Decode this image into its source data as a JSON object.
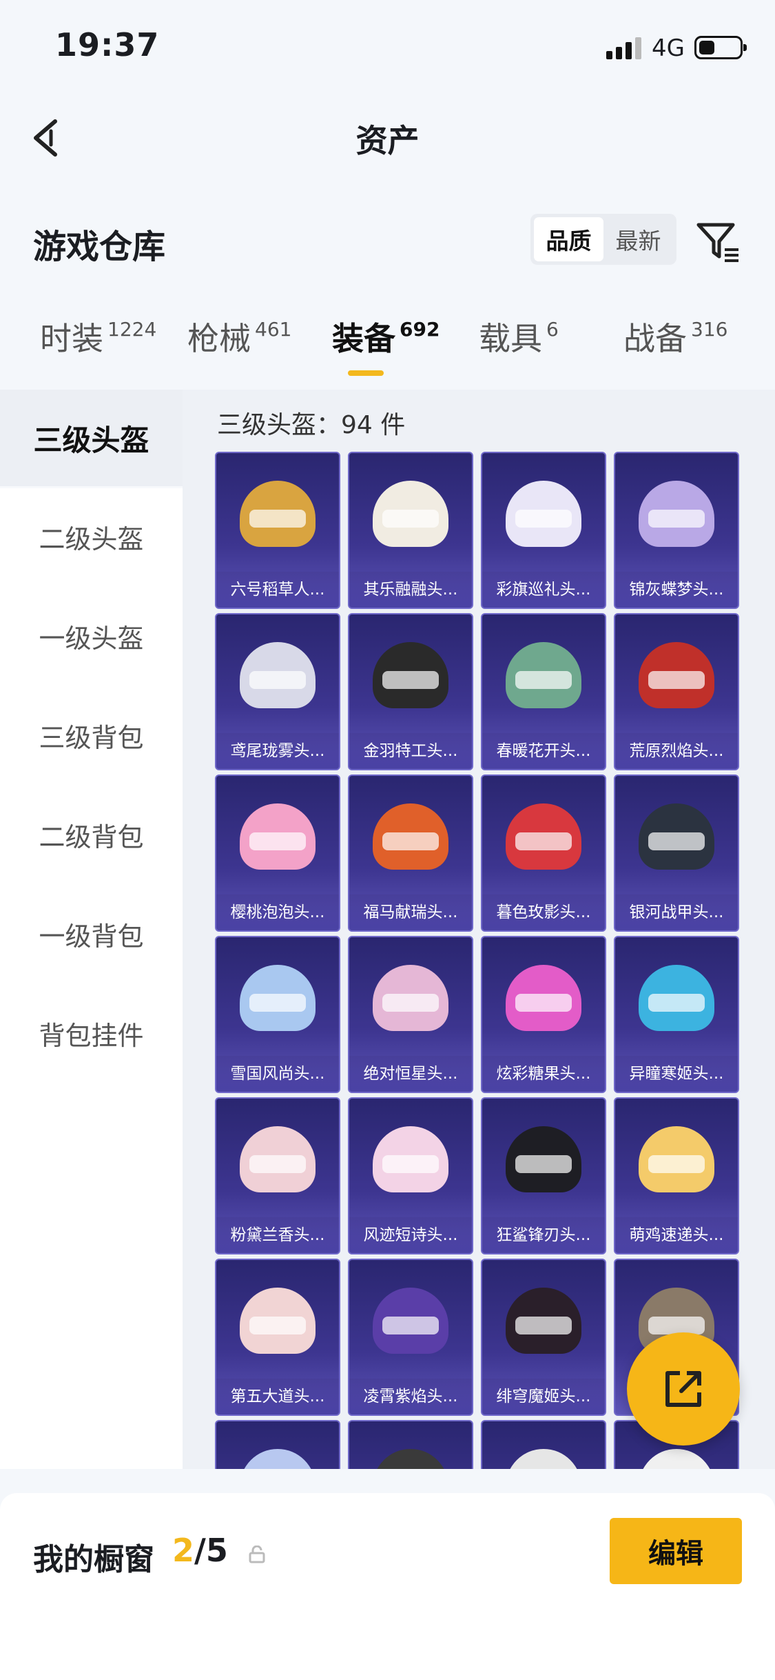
{
  "status_bar": {
    "time": "19:37",
    "network": "4G"
  },
  "nav": {
    "title": "资产"
  },
  "warehouse": {
    "title": "游戏仓库",
    "sort_options": [
      {
        "label": "品质",
        "active": true
      },
      {
        "label": "最新",
        "active": false
      }
    ]
  },
  "tabs": [
    {
      "label": "时装",
      "count": "1224",
      "active": false
    },
    {
      "label": "枪械",
      "count": "461",
      "active": false
    },
    {
      "label": "装备",
      "count": "692",
      "active": true
    },
    {
      "label": "载具",
      "count": "6",
      "active": false
    },
    {
      "label": "战备",
      "count": "316",
      "active": false
    }
  ],
  "sidebar": {
    "items": [
      {
        "label": "三级头盔",
        "active": true
      },
      {
        "label": "二级头盔",
        "active": false
      },
      {
        "label": "一级头盔",
        "active": false
      },
      {
        "label": "三级背包",
        "active": false
      },
      {
        "label": "二级背包",
        "active": false
      },
      {
        "label": "一级背包",
        "active": false
      },
      {
        "label": "背包挂件",
        "active": false
      }
    ]
  },
  "grid": {
    "count_label": "三级头盔：94 件",
    "items": [
      {
        "name": "六号稻草人...",
        "color": "#d9a440"
      },
      {
        "name": "其乐融融头...",
        "color": "#f1ece2"
      },
      {
        "name": "彩旗巡礼头...",
        "color": "#e9e6f7"
      },
      {
        "name": "锦灰蝶梦头...",
        "color": "#b9a8e6"
      },
      {
        "name": "鸢尾珑雾头...",
        "color": "#d8d9e8"
      },
      {
        "name": "金羽特工头...",
        "color": "#2a2a2a"
      },
      {
        "name": "春暖花开头...",
        "color": "#6fa88e"
      },
      {
        "name": "荒原烈焰头...",
        "color": "#c0302a"
      },
      {
        "name": "樱桃泡泡头...",
        "color": "#f3a2c8"
      },
      {
        "name": "福马献瑞头...",
        "color": "#e0602a"
      },
      {
        "name": "暮色玫影头...",
        "color": "#d8383e"
      },
      {
        "name": "银河战甲头...",
        "color": "#2b3340"
      },
      {
        "name": "雪国风尚头...",
        "color": "#a9c8f0"
      },
      {
        "name": "绝对恒星头...",
        "color": "#e5b7d6"
      },
      {
        "name": "炫彩糖果头...",
        "color": "#e35cc8"
      },
      {
        "name": "异瞳寒姬头...",
        "color": "#3cb3e0"
      },
      {
        "name": "粉黛兰香头...",
        "color": "#f0d0d6"
      },
      {
        "name": "风迹短诗头...",
        "color": "#f3d3e6"
      },
      {
        "name": "狂鲨锋刃头...",
        "color": "#1e1e24"
      },
      {
        "name": "萌鸡速递头...",
        "color": "#f4cb6a"
      },
      {
        "name": "第五大道头...",
        "color": "#f1d4d4"
      },
      {
        "name": "凌霄紫焰头...",
        "color": "#5a3ea8"
      },
      {
        "name": "绯穹魔姬头...",
        "color": "#2a1f2a"
      },
      {
        "name": "",
        "color": "#8a7a68"
      },
      {
        "name": "",
        "color": "#b8c8f0"
      },
      {
        "name": "",
        "color": "#3a3a3a"
      },
      {
        "name": "",
        "color": "#e6e6e6"
      },
      {
        "name": "",
        "color": "#f0f0f0"
      }
    ]
  },
  "footer": {
    "title": "我的橱窗",
    "current": "2",
    "total": "/5",
    "edit_label": "编辑"
  },
  "colors": {
    "accent": "#f6b617",
    "card_bg": "#3d3590"
  }
}
